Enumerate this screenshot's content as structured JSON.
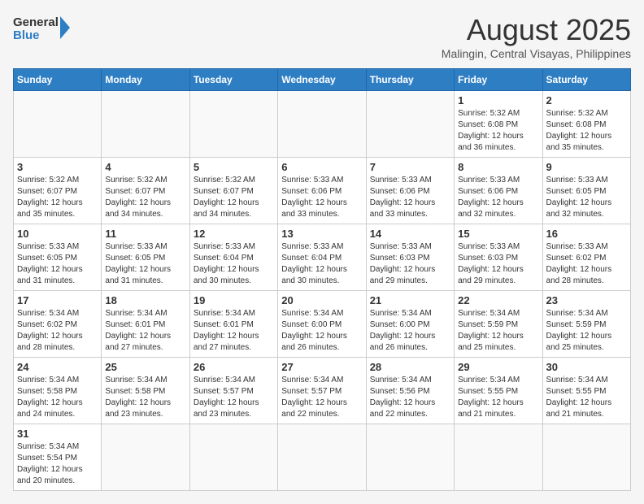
{
  "logo": {
    "general": "General",
    "blue": "Blue"
  },
  "header": {
    "month": "August 2025",
    "location": "Malingin, Central Visayas, Philippines"
  },
  "days": [
    "Sunday",
    "Monday",
    "Tuesday",
    "Wednesday",
    "Thursday",
    "Friday",
    "Saturday"
  ],
  "weeks": [
    [
      {
        "date": "",
        "info": ""
      },
      {
        "date": "",
        "info": ""
      },
      {
        "date": "",
        "info": ""
      },
      {
        "date": "",
        "info": ""
      },
      {
        "date": "",
        "info": ""
      },
      {
        "date": "1",
        "info": "Sunrise: 5:32 AM\nSunset: 6:08 PM\nDaylight: 12 hours and 36 minutes."
      },
      {
        "date": "2",
        "info": "Sunrise: 5:32 AM\nSunset: 6:08 PM\nDaylight: 12 hours and 35 minutes."
      }
    ],
    [
      {
        "date": "3",
        "info": "Sunrise: 5:32 AM\nSunset: 6:07 PM\nDaylight: 12 hours and 35 minutes."
      },
      {
        "date": "4",
        "info": "Sunrise: 5:32 AM\nSunset: 6:07 PM\nDaylight: 12 hours and 34 minutes."
      },
      {
        "date": "5",
        "info": "Sunrise: 5:32 AM\nSunset: 6:07 PM\nDaylight: 12 hours and 34 minutes."
      },
      {
        "date": "6",
        "info": "Sunrise: 5:33 AM\nSunset: 6:06 PM\nDaylight: 12 hours and 33 minutes."
      },
      {
        "date": "7",
        "info": "Sunrise: 5:33 AM\nSunset: 6:06 PM\nDaylight: 12 hours and 33 minutes."
      },
      {
        "date": "8",
        "info": "Sunrise: 5:33 AM\nSunset: 6:06 PM\nDaylight: 12 hours and 32 minutes."
      },
      {
        "date": "9",
        "info": "Sunrise: 5:33 AM\nSunset: 6:05 PM\nDaylight: 12 hours and 32 minutes."
      }
    ],
    [
      {
        "date": "10",
        "info": "Sunrise: 5:33 AM\nSunset: 6:05 PM\nDaylight: 12 hours and 31 minutes."
      },
      {
        "date": "11",
        "info": "Sunrise: 5:33 AM\nSunset: 6:05 PM\nDaylight: 12 hours and 31 minutes."
      },
      {
        "date": "12",
        "info": "Sunrise: 5:33 AM\nSunset: 6:04 PM\nDaylight: 12 hours and 30 minutes."
      },
      {
        "date": "13",
        "info": "Sunrise: 5:33 AM\nSunset: 6:04 PM\nDaylight: 12 hours and 30 minutes."
      },
      {
        "date": "14",
        "info": "Sunrise: 5:33 AM\nSunset: 6:03 PM\nDaylight: 12 hours and 29 minutes."
      },
      {
        "date": "15",
        "info": "Sunrise: 5:33 AM\nSunset: 6:03 PM\nDaylight: 12 hours and 29 minutes."
      },
      {
        "date": "16",
        "info": "Sunrise: 5:33 AM\nSunset: 6:02 PM\nDaylight: 12 hours and 28 minutes."
      }
    ],
    [
      {
        "date": "17",
        "info": "Sunrise: 5:34 AM\nSunset: 6:02 PM\nDaylight: 12 hours and 28 minutes."
      },
      {
        "date": "18",
        "info": "Sunrise: 5:34 AM\nSunset: 6:01 PM\nDaylight: 12 hours and 27 minutes."
      },
      {
        "date": "19",
        "info": "Sunrise: 5:34 AM\nSunset: 6:01 PM\nDaylight: 12 hours and 27 minutes."
      },
      {
        "date": "20",
        "info": "Sunrise: 5:34 AM\nSunset: 6:00 PM\nDaylight: 12 hours and 26 minutes."
      },
      {
        "date": "21",
        "info": "Sunrise: 5:34 AM\nSunset: 6:00 PM\nDaylight: 12 hours and 26 minutes."
      },
      {
        "date": "22",
        "info": "Sunrise: 5:34 AM\nSunset: 5:59 PM\nDaylight: 12 hours and 25 minutes."
      },
      {
        "date": "23",
        "info": "Sunrise: 5:34 AM\nSunset: 5:59 PM\nDaylight: 12 hours and 25 minutes."
      }
    ],
    [
      {
        "date": "24",
        "info": "Sunrise: 5:34 AM\nSunset: 5:58 PM\nDaylight: 12 hours and 24 minutes."
      },
      {
        "date": "25",
        "info": "Sunrise: 5:34 AM\nSunset: 5:58 PM\nDaylight: 12 hours and 23 minutes."
      },
      {
        "date": "26",
        "info": "Sunrise: 5:34 AM\nSunset: 5:57 PM\nDaylight: 12 hours and 23 minutes."
      },
      {
        "date": "27",
        "info": "Sunrise: 5:34 AM\nSunset: 5:57 PM\nDaylight: 12 hours and 22 minutes."
      },
      {
        "date": "28",
        "info": "Sunrise: 5:34 AM\nSunset: 5:56 PM\nDaylight: 12 hours and 22 minutes."
      },
      {
        "date": "29",
        "info": "Sunrise: 5:34 AM\nSunset: 5:55 PM\nDaylight: 12 hours and 21 minutes."
      },
      {
        "date": "30",
        "info": "Sunrise: 5:34 AM\nSunset: 5:55 PM\nDaylight: 12 hours and 21 minutes."
      }
    ],
    [
      {
        "date": "31",
        "info": "Sunrise: 5:34 AM\nSunset: 5:54 PM\nDaylight: 12 hours and 20 minutes."
      },
      {
        "date": "",
        "info": ""
      },
      {
        "date": "",
        "info": ""
      },
      {
        "date": "",
        "info": ""
      },
      {
        "date": "",
        "info": ""
      },
      {
        "date": "",
        "info": ""
      },
      {
        "date": "",
        "info": ""
      }
    ]
  ]
}
